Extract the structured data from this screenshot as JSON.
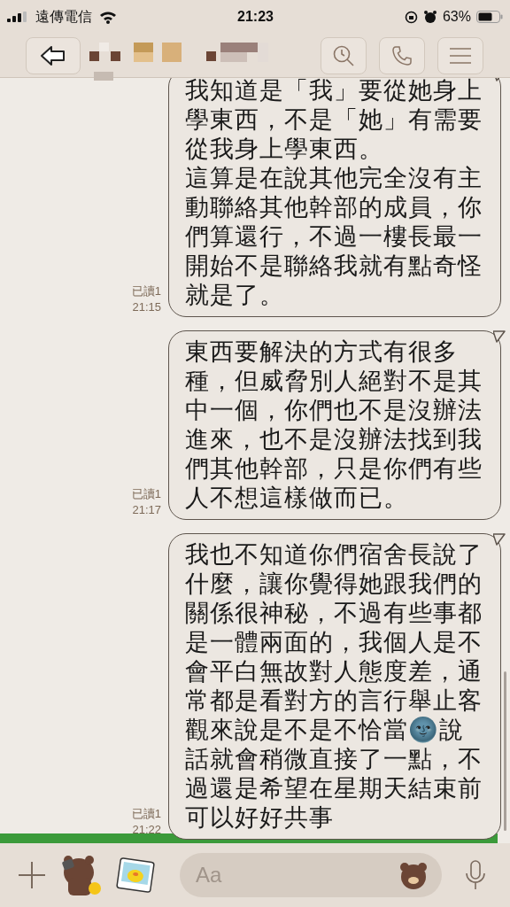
{
  "status_bar": {
    "carrier": "遠傳電信",
    "time": "21:23",
    "battery": "63%"
  },
  "messages": [
    {
      "read": "已讀1",
      "time": "21:15",
      "paragraphs": [
        "我知道是「我」要從她身上學東西，不是「她」有需要從我身上學東西。",
        "這算是在說其他完全沒有主動聯絡其他幹部的成員，你們算還行，不過一樓長最一開始不是聯絡我就有點奇怪就是了。"
      ]
    },
    {
      "read": "已讀1",
      "time": "21:17",
      "paragraphs": [
        "東西要解決的方式有很多種，但威脅別人絕對不是其中一個，你們也不是沒辦法進來，也不是沒辦法找到我們其他幹部，只是你們有些人不想這樣做而已。"
      ]
    },
    {
      "read": "已讀1",
      "time": "21:22",
      "paragraphs": [
        "我也不知道你們宿舍長說了什麼，讓你覺得她跟我們的關係很神秘，不過有些事都是一體兩面的，我個人是不會平白無故對人態度差，通常都是看對方的言行舉止客觀來說是不是不恰當🌚說話就會稍微直接了一點，不過還是希望在星期天結束前可以好好共事"
      ]
    }
  ],
  "composer": {
    "placeholder": "Aa"
  }
}
